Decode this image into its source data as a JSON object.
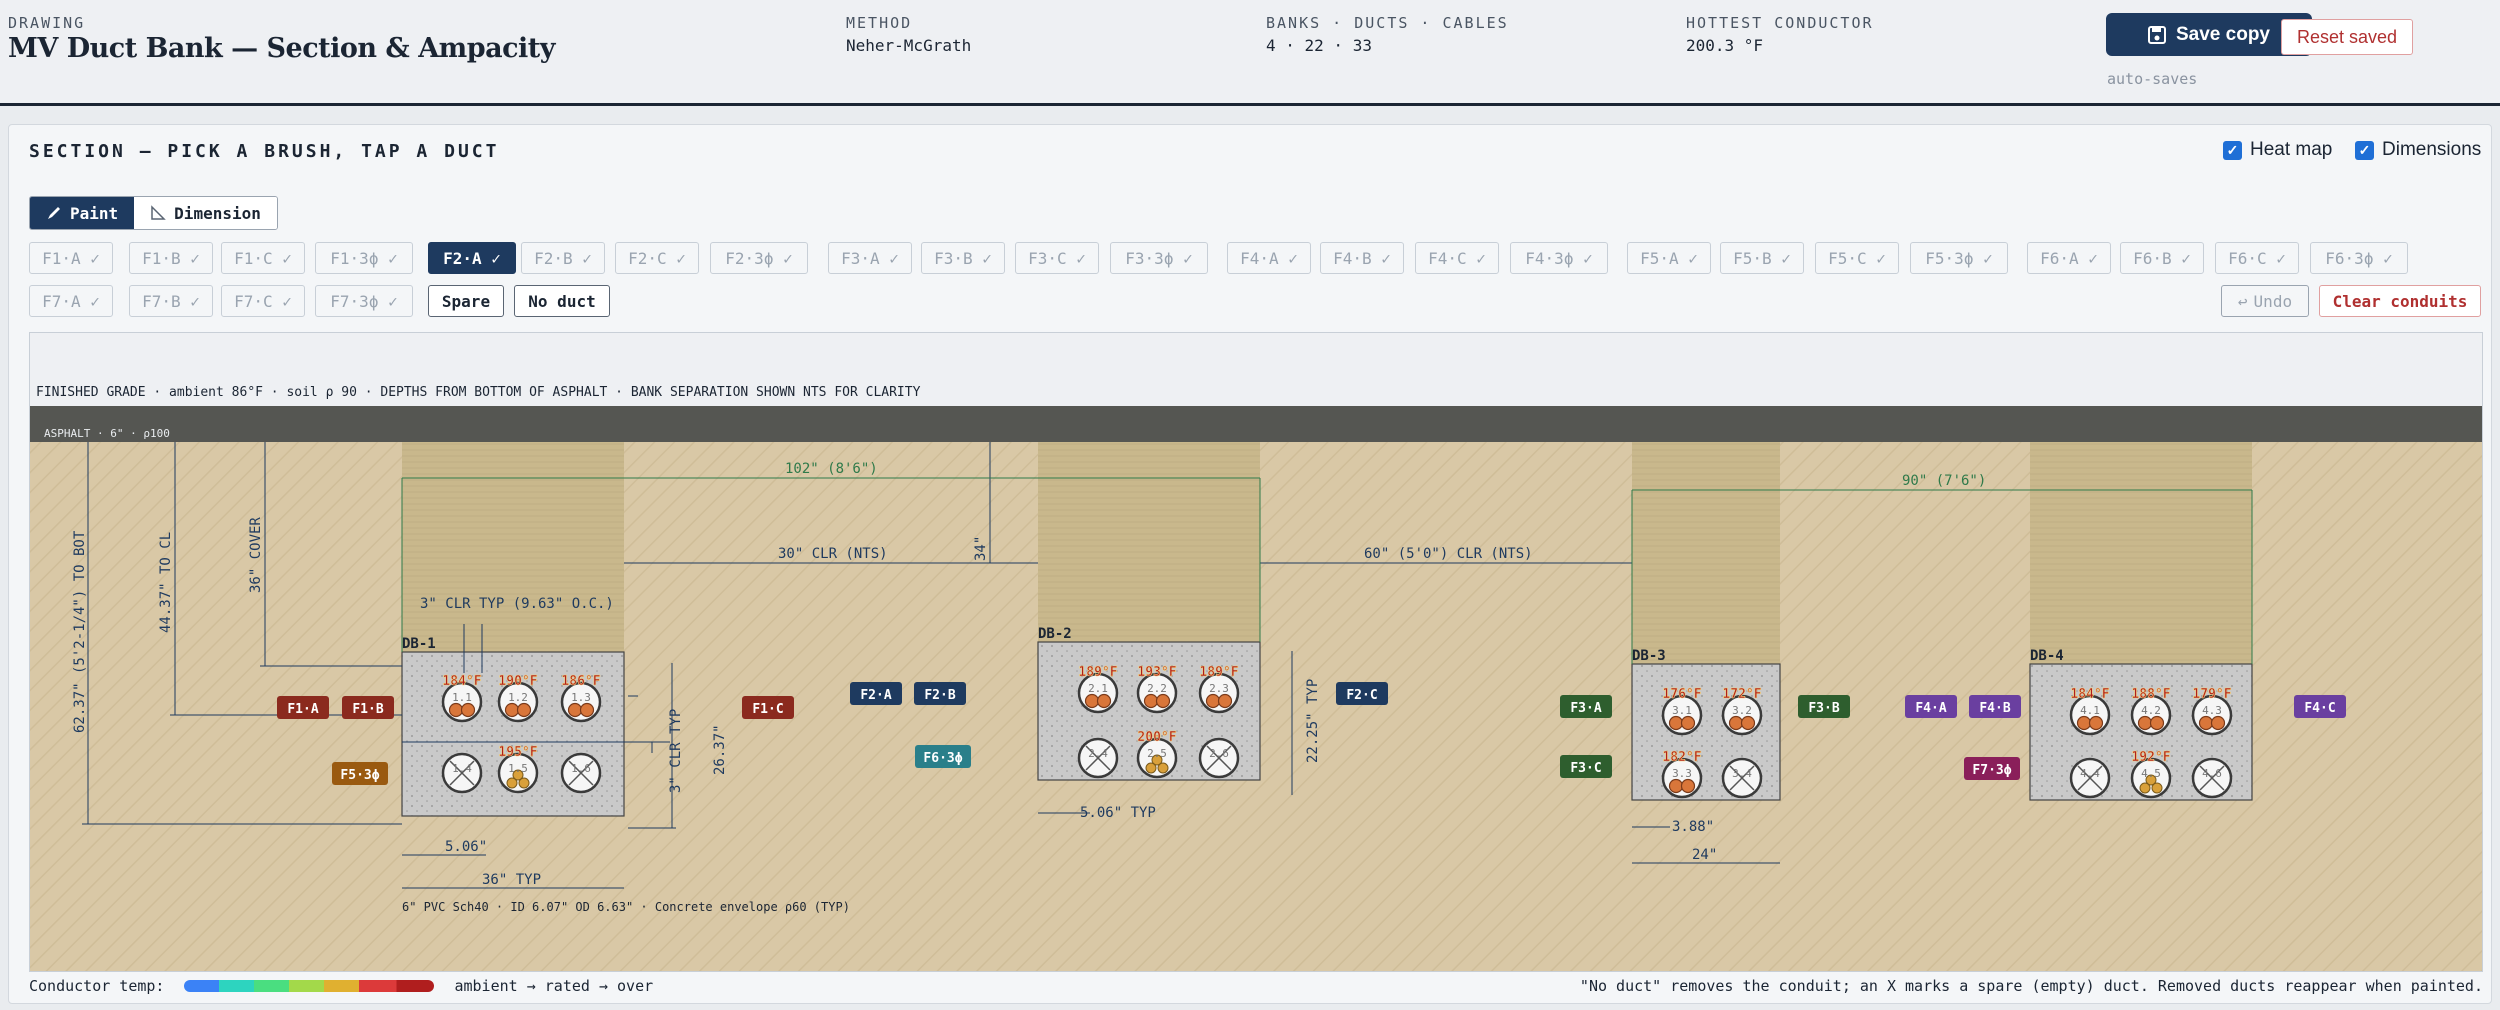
{
  "header": {
    "drawing_label": "DRAWING",
    "title": "MV Duct Bank — Section & Ampacity",
    "method_label": "METHOD",
    "method_value": "Neher-McGrath",
    "counts_label": "BANKS · DUCTS · CABLES",
    "counts_value": "4 · 22 · 33",
    "hottest_label": "HOTTEST CONDUCTOR",
    "hottest_value": "200.3 °F",
    "save_label": "Save copy",
    "reset_label": "Reset saved",
    "autosave": "auto-saves"
  },
  "toolbar": {
    "section_title": "SECTION — PICK A BRUSH, TAP A DUCT",
    "heatmap_label": "Heat map",
    "dimensions_label": "Dimensions",
    "paint_label": "Paint",
    "dimension_label": "Dimension",
    "undo_label": "Undo",
    "clear_label": "Clear conduits"
  },
  "brushes_row1": [
    "F1·A ✓",
    "F1·B ✓",
    "F1·C ✓",
    "F1·3ϕ ✓",
    "F2·A ✓",
    "F2·B ✓",
    "F2·C ✓",
    "F2·3ϕ ✓",
    "F3·A ✓",
    "F3·B ✓",
    "F3·C ✓",
    "F3·3ϕ ✓",
    "F4·A ✓",
    "F4·B ✓",
    "F4·C ✓",
    "F4·3ϕ ✓",
    "F5·A ✓",
    "F5·B ✓",
    "F5·C ✓",
    "F5·3ϕ ✓",
    "F6·A ✓",
    "F6·B ✓",
    "F6·C ✓",
    "F6·3ϕ ✓"
  ],
  "brushes_row2": [
    "F7·A ✓",
    "F7·B ✓",
    "F7·C ✓",
    "F7·3ϕ ✓",
    "Spare",
    "No duct"
  ],
  "selected_brush": "F2·A ✓",
  "section": {
    "grade_note": "FINISHED GRADE · ambient 86°F · soil ρ 90 · DEPTHS FROM BOTTOM OF ASPHALT · BANK SEPARATION SHOWN NTS FOR CLARITY",
    "asphalt_label": "ASPHALT · 6\" · ρ100",
    "dims": {
      "to_bot": "62.37\" (5'2-1/4\") TO BOT",
      "to_cl": "44.37\" TO CL",
      "cover": "36\" COVER",
      "clr_typ": "3\" CLR TYP (9.63\" O.C.)",
      "span_db1_db2": "102\" (8'6\")",
      "clr_30": "30\" CLR (NTS)",
      "dim_34": "34\"",
      "clr_60": "60\" (5'0\") CLR (NTS)",
      "span_db3_db4": "90\" (7'6\")",
      "h_26": "26.37\"",
      "clr_3_typ": "3\" CLR TYP",
      "w_506": "5.06\"",
      "w_36": "36\" TYP",
      "w_506_typ": "5.06\" TYP",
      "h_2225": "22.25\" TYP",
      "w_388": "3.88\"",
      "w_24": "24\""
    },
    "pvc_note": "6\" PVC Sch40 · ID 6.07\" OD 6.63\" · Concrete envelope ρ60 (TYP)",
    "banks": [
      {
        "name": "DB-1",
        "ducts": [
          "1.1",
          "1.2",
          "1.3",
          "1.4",
          "1.5",
          "1.6"
        ],
        "temps": [
          "184°F",
          "190°F",
          "186°F",
          "",
          "195°F",
          ""
        ]
      },
      {
        "name": "DB-2",
        "ducts": [
          "2.1",
          "2.2",
          "2.3",
          "2.4",
          "2.5",
          "2.6"
        ],
        "temps": [
          "189°F",
          "193°F",
          "189°F",
          "",
          "200°F",
          ""
        ]
      },
      {
        "name": "DB-3",
        "ducts": [
          "3.1",
          "3.2",
          "3.3",
          "3.4"
        ],
        "temps": [
          "176°F",
          "172°F",
          "182°F",
          ""
        ]
      },
      {
        "name": "DB-4",
        "ducts": [
          "4.1",
          "4.2",
          "4.3",
          "4.4",
          "4.5",
          "4.6"
        ],
        "temps": [
          "184°F",
          "188°F",
          "179°F",
          "",
          "192°F",
          ""
        ]
      }
    ],
    "tags": [
      "F1·A",
      "F1·B",
      "F1·C",
      "F5·3ϕ",
      "F2·A",
      "F2·B",
      "F2·C",
      "F6·3ϕ",
      "F3·A",
      "F3·B",
      "F3·C",
      "F4·A",
      "F4·B",
      "F4·C",
      "F7·3ϕ"
    ],
    "tag_colors": {
      "F1": "#8b2a1e",
      "F5": "#9a5a10",
      "F2": "#1e3a5f",
      "F6": "#2a7f8a",
      "F3": "#2e5e2e",
      "F4": "#6a3fa0",
      "F7": "#8a1f5a"
    }
  },
  "legend": {
    "label": "Conductor temp:",
    "scale": "ambient → rated → over",
    "note": "\"No duct\" removes the conduit; an X marks a spare (empty) duct. Removed ducts reappear when painted."
  }
}
